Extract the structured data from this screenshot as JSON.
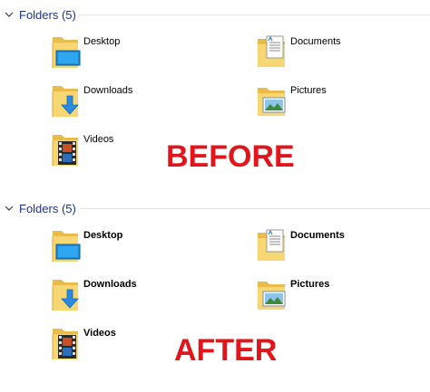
{
  "before": {
    "header": "Folders (5)",
    "items": [
      {
        "label": "Desktop",
        "icon": "desktop-folder-icon"
      },
      {
        "label": "Documents",
        "icon": "documents-folder-icon"
      },
      {
        "label": "Downloads",
        "icon": "downloads-folder-icon"
      },
      {
        "label": "Pictures",
        "icon": "pictures-folder-icon"
      },
      {
        "label": "Videos",
        "icon": "videos-folder-icon"
      }
    ],
    "caption": "BEFORE"
  },
  "after": {
    "header": "Folders (5)",
    "items": [
      {
        "label": "Desktop",
        "icon": "desktop-folder-icon"
      },
      {
        "label": "Documents",
        "icon": "documents-folder-icon"
      },
      {
        "label": "Downloads",
        "icon": "downloads-folder-icon"
      },
      {
        "label": "Pictures",
        "icon": "pictures-folder-icon"
      },
      {
        "label": "Videos",
        "icon": "videos-folder-icon"
      }
    ],
    "caption": "AFTER"
  },
  "colors": {
    "header_text": "#1e3287",
    "caption": "#e4141b",
    "folder": "#f7d774"
  }
}
